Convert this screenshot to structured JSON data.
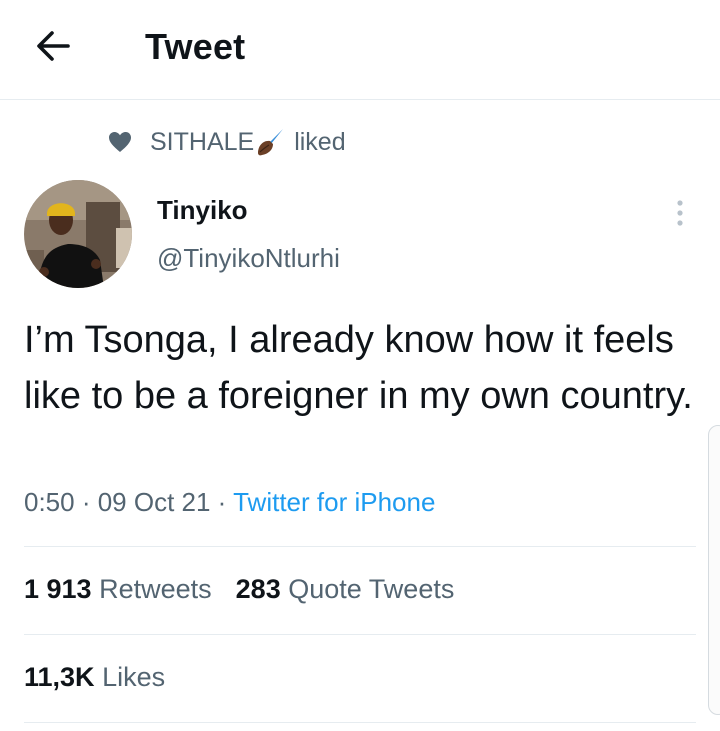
{
  "header": {
    "title": "Tweet",
    "back_icon": "arrow-left-icon"
  },
  "social_context": {
    "user": "SITHALE",
    "verb": "liked",
    "icon": "heart-icon",
    "emoji": "quill-pen-icon"
  },
  "author": {
    "display_name": "Tinyiko",
    "handle": "@TinyikoNtlurhi",
    "avatar": "avatar-photo"
  },
  "tweet": {
    "text": "I’m Tsonga, I already know how it feels like to be a foreigner in my own country.",
    "time": "0:50",
    "separator": " · ",
    "date": "09 Oct 21",
    "source": "Twitter for iPhone"
  },
  "stats": {
    "retweets_count": "1 913",
    "retweets_label": "Retweets",
    "quotes_count": "283",
    "quotes_label": "Quote Tweets",
    "likes_count": "11,3K",
    "likes_label": "Likes"
  },
  "colors": {
    "text": "#0f1419",
    "secondary": "#536471",
    "link": "#1d9bf0",
    "border": "#e6ecf0"
  }
}
